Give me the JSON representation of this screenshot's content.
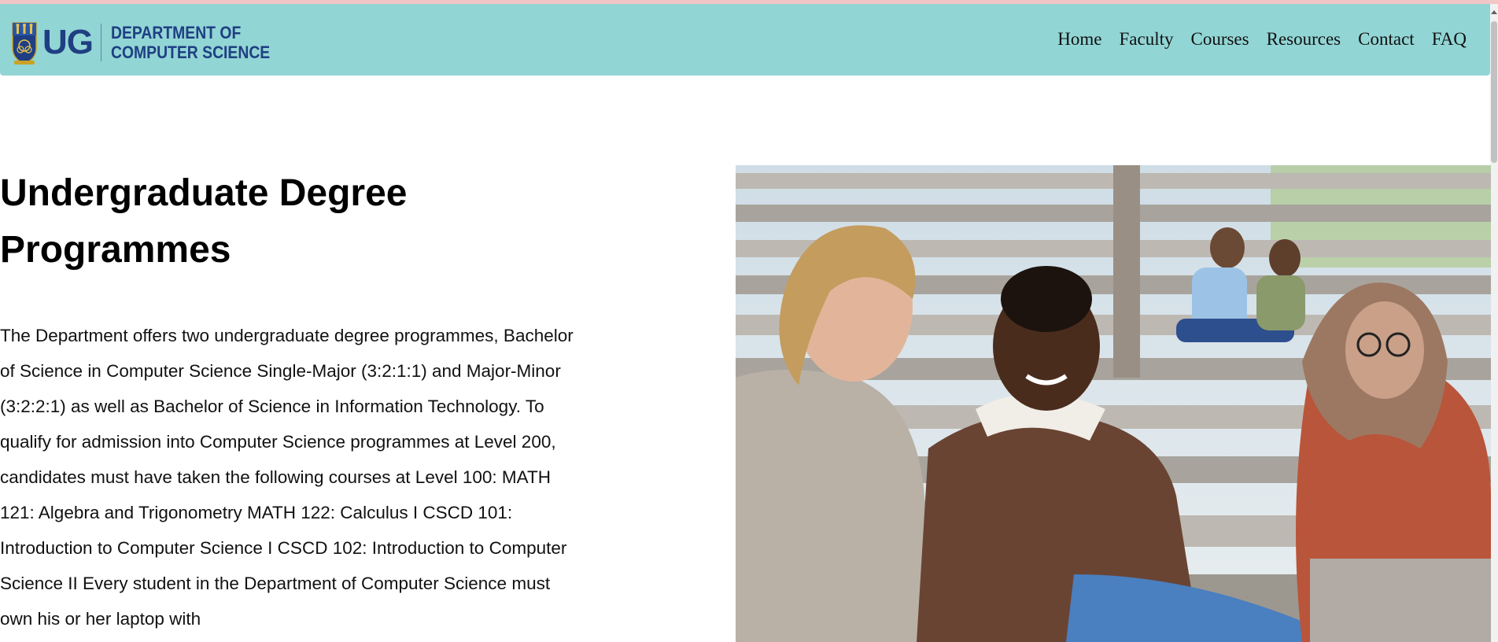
{
  "header": {
    "logo_ug": "UG",
    "logo_line1": "DEPARTMENT OF",
    "logo_line2": "COMPUTER SCIENCE"
  },
  "nav": {
    "items": [
      {
        "label": "Home"
      },
      {
        "label": "Faculty"
      },
      {
        "label": "Courses"
      },
      {
        "label": "Resources"
      },
      {
        "label": "Contact"
      },
      {
        "label": "FAQ"
      }
    ]
  },
  "main": {
    "title": "Undergraduate Degree Programmes",
    "body": "The Department offers two undergraduate degree programmes, Bachelor of Science in Computer Science Single-Major (3:2:1:1) and Major-Minor (3:2:2:1) as well as Bachelor of Science in Information Technology. To qualify for admission into Computer Science programmes at Level 200, candidates must have taken the following courses at Level 100: MATH 121: Algebra and Trigonometry MATH 122: Calculus I CSCD 101: Introduction to Computer Science I CSCD 102: Introduction to Computer Science II Every student in the Department of Computer Science must own his or her laptop with"
  },
  "colors": {
    "header_bg": "#92d5d5",
    "brand_navy": "#1f3f82"
  },
  "icons": {
    "crest": "university-crest-icon"
  }
}
